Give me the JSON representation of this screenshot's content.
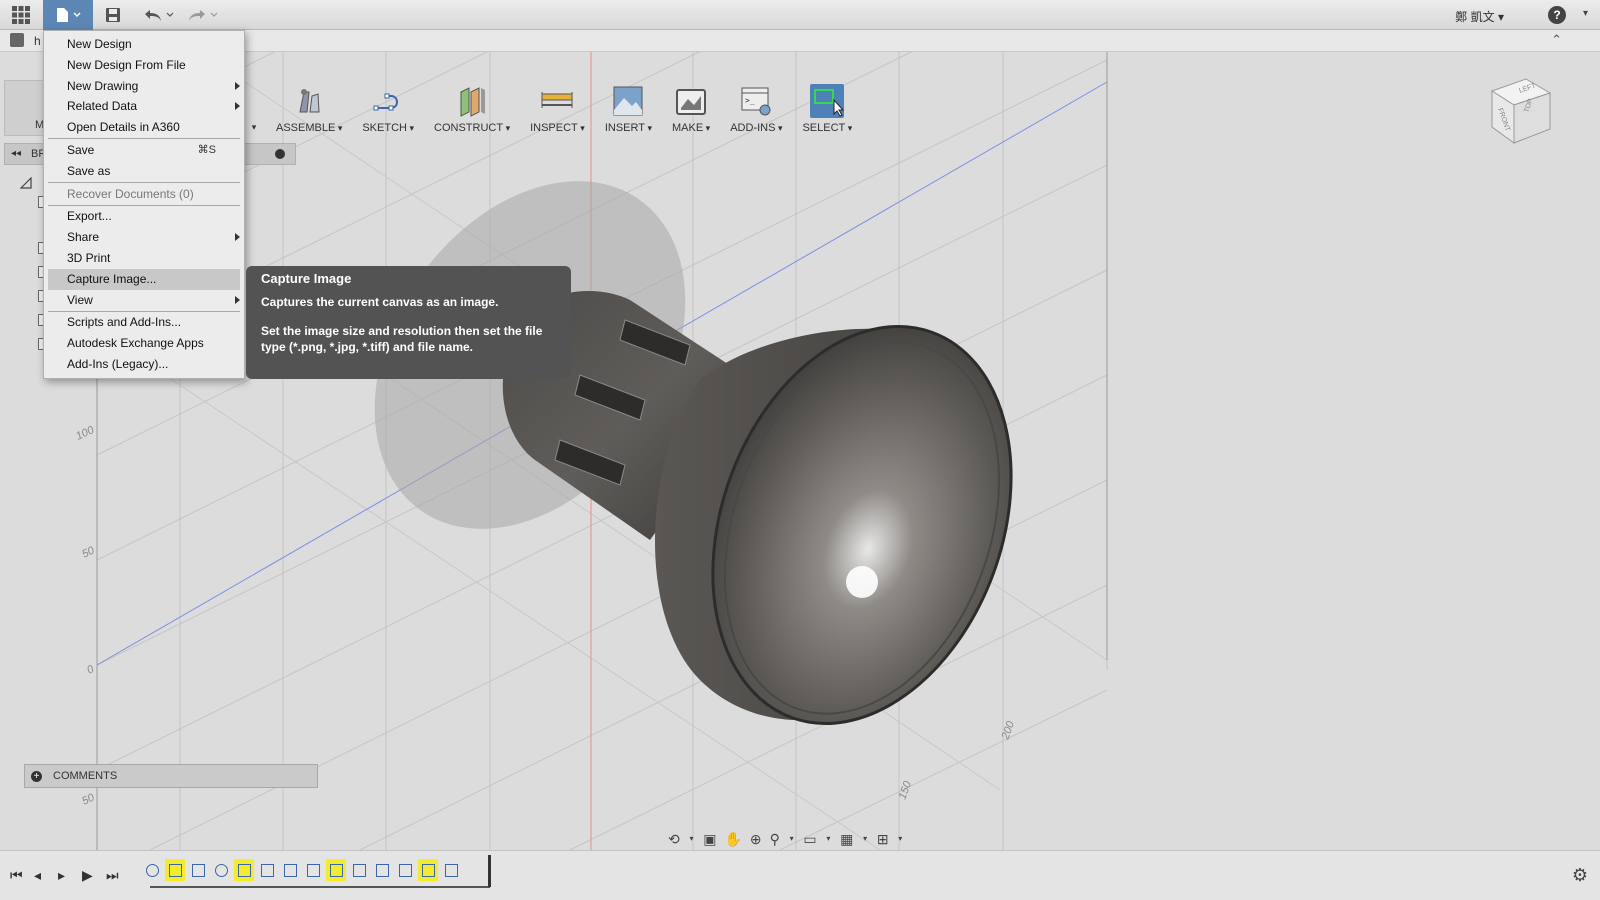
{
  "app": {
    "user_name": "鄭 凱文",
    "help_label": "?"
  },
  "toolbar": {
    "items": [
      {
        "label": "ASSEMBLE"
      },
      {
        "label": "SKETCH"
      },
      {
        "label": "CONSTRUCT"
      },
      {
        "label": "INSPECT"
      },
      {
        "label": "INSERT"
      },
      {
        "label": "MAKE"
      },
      {
        "label": "ADD-INS"
      },
      {
        "label": "SELECT"
      }
    ]
  },
  "browser": {
    "label": "BR"
  },
  "file_menu": {
    "items": [
      {
        "label": "New Design"
      },
      {
        "label": "New Design From File"
      },
      {
        "label": "New Drawing"
      },
      {
        "label": "Related Data"
      },
      {
        "label": "Open Details in A360"
      },
      {
        "label": "Save",
        "shortcut": "⌘S"
      },
      {
        "label": "Save as"
      },
      {
        "label": "Recover Documents (0)"
      },
      {
        "label": "Export..."
      },
      {
        "label": "Share"
      },
      {
        "label": "3D Print"
      },
      {
        "label": "Capture Image..."
      },
      {
        "label": "View"
      },
      {
        "label": "Scripts and Add-Ins..."
      },
      {
        "label": "Autodesk Exchange Apps"
      },
      {
        "label": "Add-Ins (Legacy)..."
      }
    ]
  },
  "tooltip": {
    "title": "Capture Image",
    "line1": "Captures the current canvas as an image.",
    "line2": "Set the image size and resolution then set the file type (*.png, *.jpg, *.tiff) and file name."
  },
  "grid_labels": {
    "y100": "100",
    "y50": "50",
    "y0": "0",
    "yneg50": "50",
    "x150": "150",
    "x200": "200"
  },
  "viewcube": {
    "left": "LEFT",
    "front": "FRONT",
    "top": "TOP"
  },
  "comments": {
    "label": "COMMENTS"
  }
}
